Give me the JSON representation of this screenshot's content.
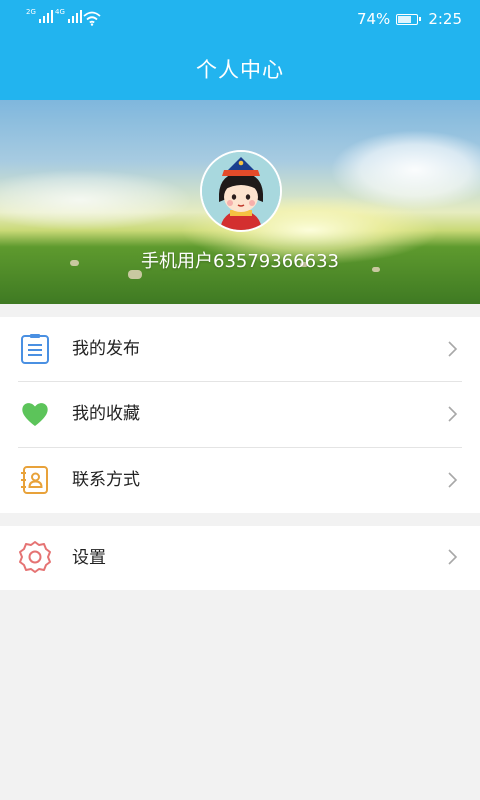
{
  "status_bar": {
    "net1": "2G",
    "net2": "4G",
    "battery_percent_text": "74%",
    "battery_level": 0.74,
    "time": "2:25"
  },
  "header": {
    "title": "个人中心"
  },
  "profile": {
    "username": "手机用户63579366633"
  },
  "menu": {
    "items": [
      {
        "label": "我的发布",
        "icon": "clipboard-list-icon",
        "color": "#4a90e2"
      },
      {
        "label": "我的收藏",
        "icon": "heart-icon",
        "color": "#5cc45a"
      },
      {
        "label": "联系方式",
        "icon": "contact-book-icon",
        "color": "#e8a23a"
      }
    ],
    "settings": {
      "label": "设置",
      "icon": "gear-icon",
      "color": "#e57373"
    }
  },
  "colors": {
    "accent": "#22b4ef",
    "background": "#f2f2f2"
  }
}
